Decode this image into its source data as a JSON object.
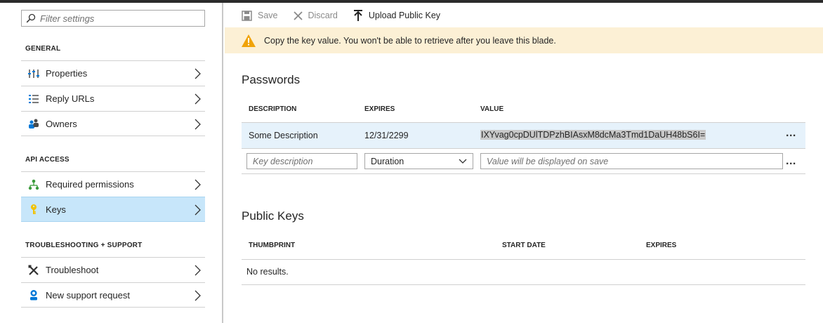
{
  "filter": {
    "placeholder": "Filter settings"
  },
  "sections": [
    {
      "title": "GENERAL",
      "items": [
        {
          "label": "Properties",
          "icon": "properties-icon"
        },
        {
          "label": "Reply URLs",
          "icon": "reply-urls-icon"
        },
        {
          "label": "Owners",
          "icon": "owners-icon"
        }
      ]
    },
    {
      "title": "API ACCESS",
      "items": [
        {
          "label": "Required permissions",
          "icon": "permissions-icon"
        },
        {
          "label": "Keys",
          "icon": "key-icon",
          "selected": true
        }
      ]
    },
    {
      "title": "TROUBLESHOOTING + SUPPORT",
      "items": [
        {
          "label": "Troubleshoot",
          "icon": "troubleshoot-icon"
        },
        {
          "label": "New support request",
          "icon": "support-request-icon"
        }
      ]
    }
  ],
  "toolbar": {
    "save_label": "Save",
    "discard_label": "Discard",
    "upload_label": "Upload Public Key"
  },
  "warning": {
    "text": "Copy the key value. You won't be able to retrieve after you leave this blade."
  },
  "passwords": {
    "title": "Passwords",
    "columns": [
      "DESCRIPTION",
      "EXPIRES",
      "VALUE"
    ],
    "row": {
      "description": "Some Description",
      "expires": "12/31/2299",
      "value": "IXYvag0cpDUlTDPzhBIAsxM8dcMa3Tmd1DaUH48bS6I="
    },
    "new_row": {
      "description_placeholder": "Key description",
      "duration_value": "Duration",
      "value_placeholder": "Value will be displayed on save"
    },
    "more_label": "..."
  },
  "public_keys": {
    "title": "Public Keys",
    "columns": [
      "THUMBPRINT",
      "START DATE",
      "EXPIRES"
    ],
    "empty_text": "No results."
  },
  "colors": {
    "accent": "#0078d7",
    "selected_bg": "#c7e6fa",
    "warning_bg": "#fcf0d5",
    "warning_icon": "#f0a30a"
  }
}
